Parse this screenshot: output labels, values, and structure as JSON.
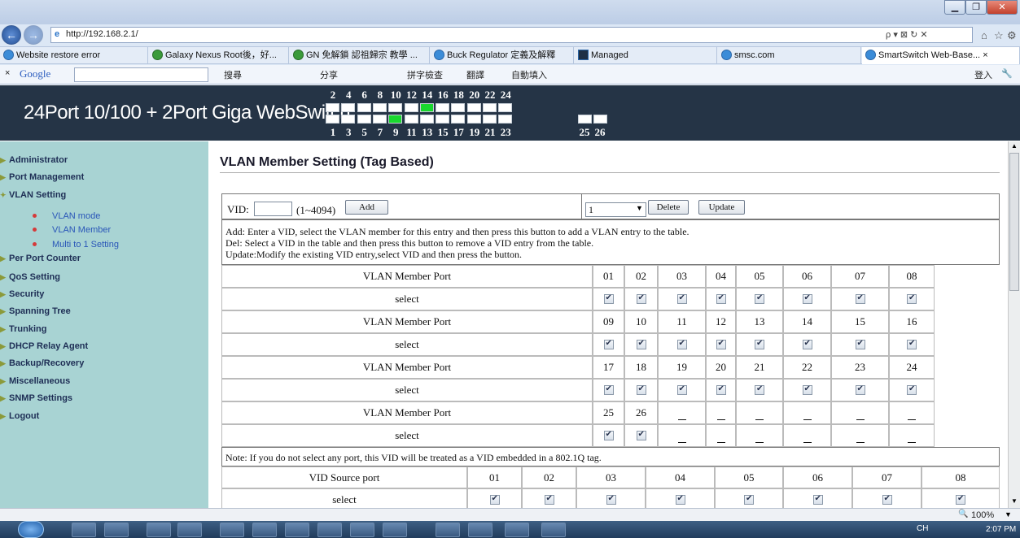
{
  "browser": {
    "url": "http://192.168.2.1/",
    "tabs": [
      "Website restore error",
      "Galaxy Nexus Root後，好...",
      "GN 免解鎖 認祖歸宗 教學 ...",
      "Buck Regulator 定義及解釋",
      "Managed",
      "smsc.com",
      "SmartSwitch Web-Base..."
    ],
    "toolbar": {
      "google": "Google",
      "search": "搜尋",
      "share": "分享",
      "spell": "拼字檢查",
      "translate": "翻譯",
      "autofill": "自動填入",
      "signin": "登入"
    },
    "close_x": "×",
    "addr_icons": "ρ ▾ ⊠ ↻ ✕",
    "zoom": "100%",
    "tray": {
      "lang": "CH",
      "time": "2:07 PM"
    }
  },
  "banner": {
    "title": "24Port 10/100 + 2Port Giga WebSwitch",
    "top_nums": [
      "2",
      "4",
      "6",
      "8",
      "10",
      "12",
      "14",
      "16",
      "18",
      "20",
      "22",
      "24"
    ],
    "bottom_nums": [
      "1",
      "3",
      "5",
      "7",
      "9",
      "11",
      "13",
      "15",
      "17",
      "19",
      "21",
      "23"
    ],
    "giga_nums": [
      "25",
      "26"
    ],
    "active_ports": [
      9,
      14
    ]
  },
  "sidebar": {
    "items": [
      {
        "label": "Administrator"
      },
      {
        "label": "Port Management"
      },
      {
        "label": "VLAN Setting"
      },
      {
        "label": "Per Port Counter"
      },
      {
        "label": "QoS Setting"
      },
      {
        "label": "Security"
      },
      {
        "label": "Spanning Tree"
      },
      {
        "label": "Trunking"
      },
      {
        "label": "DHCP Relay Agent"
      },
      {
        "label": "Backup/Recovery"
      },
      {
        "label": "Miscellaneous"
      },
      {
        "label": "SNMP Settings"
      },
      {
        "label": "Logout"
      }
    ],
    "subitems": [
      {
        "label": "VLAN mode"
      },
      {
        "label": "VLAN Member"
      },
      {
        "label": "Multi to 1 Setting"
      }
    ]
  },
  "main": {
    "title": "VLAN Member Setting (Tag Based)",
    "vid_label": "VID:",
    "vid_value": "",
    "vid_range": "(1~4094)",
    "add": "Add",
    "select_value": "1",
    "delete": "Delete",
    "update": "Update",
    "help": [
      "Add: Enter a VID, select the VLAN member for this entry and then press this button to add a VLAN entry to the table.",
      "Del: Select a VID in the table and then press this button to remove a VID entry from the table.",
      "Update:Modify the existing VID entry,select VID and then press the button."
    ],
    "member_label": "VLAN Member Port",
    "select_label": "select",
    "rows": [
      [
        "01",
        "02",
        "03",
        "04",
        "05",
        "06",
        "07",
        "08"
      ],
      [
        "09",
        "10",
        "11",
        "12",
        "13",
        "14",
        "15",
        "16"
      ],
      [
        "17",
        "18",
        "19",
        "20",
        "21",
        "22",
        "23",
        "24"
      ],
      [
        "25",
        "26",
        "_",
        "_",
        "_",
        "_",
        "_",
        "_"
      ]
    ],
    "note": "Note: If you do not select any port, this VID will be treated as a VID embedded in a 802.1Q tag.",
    "source_label": "VID Source port",
    "source_ports": [
      "01",
      "02",
      "03",
      "04",
      "05",
      "06",
      "07",
      "08"
    ]
  }
}
